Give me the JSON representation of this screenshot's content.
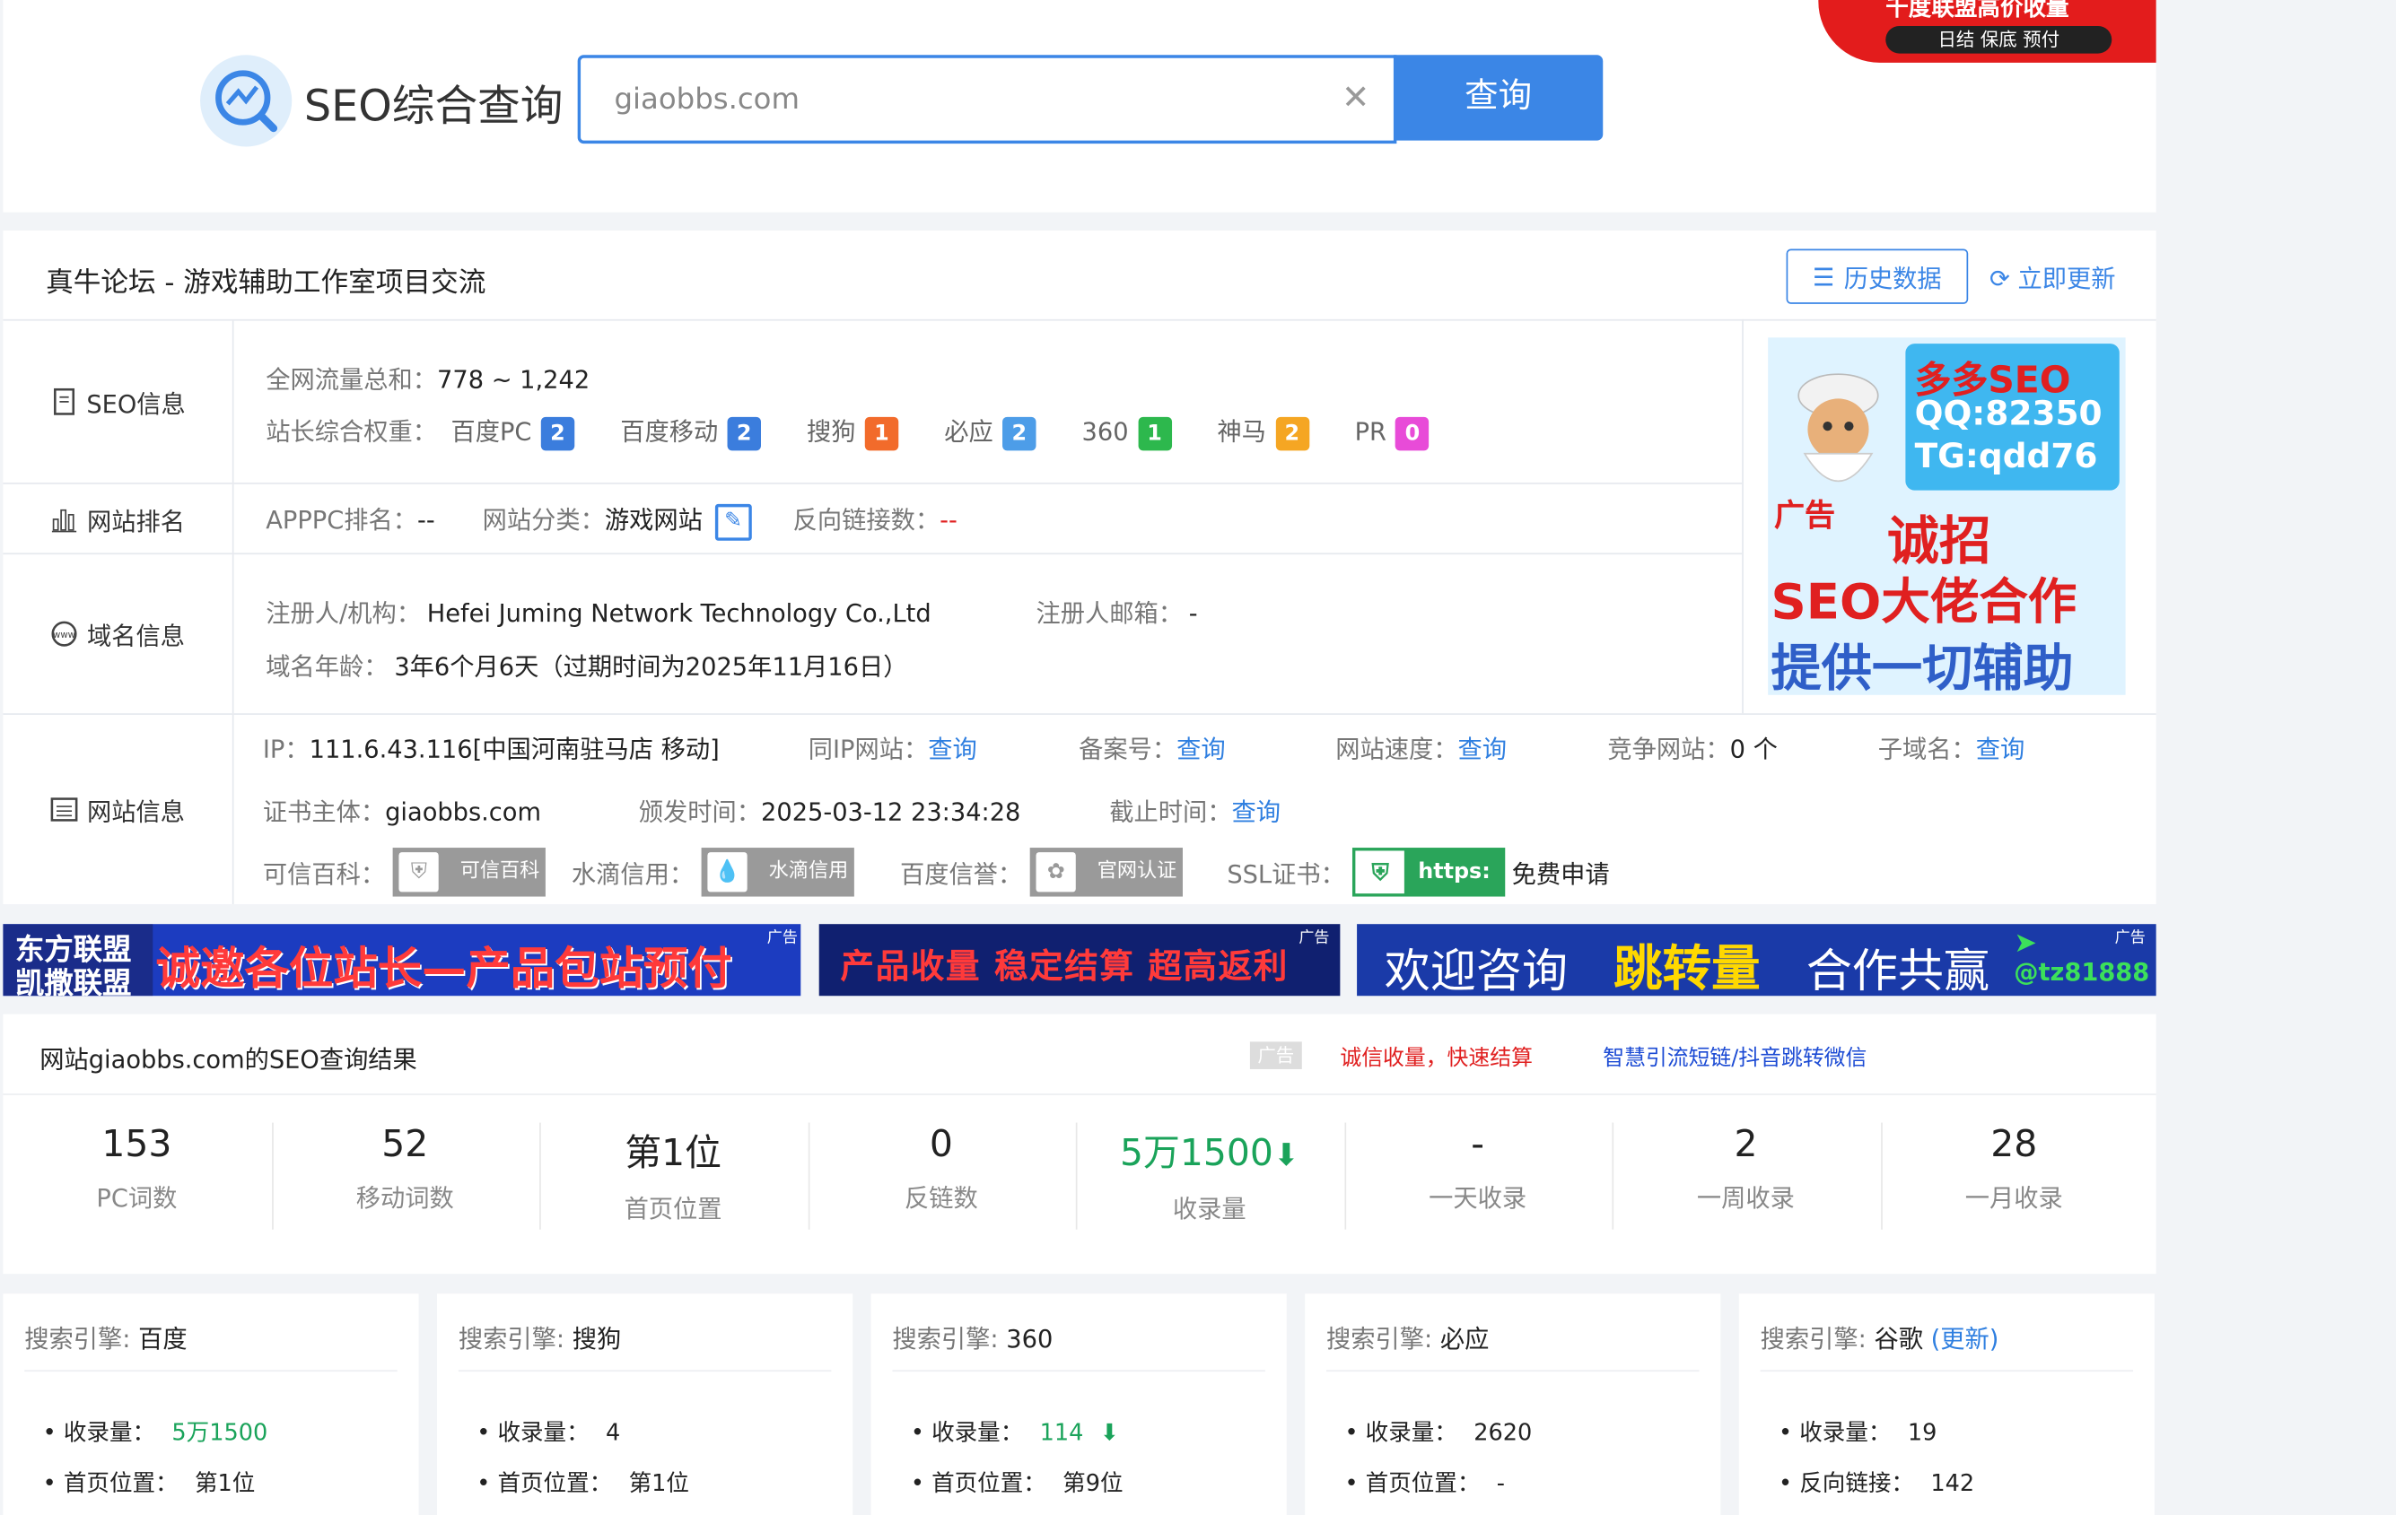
{
  "logo": {
    "title": "SEO综合查询"
  },
  "search": {
    "value": "giaobbs.com",
    "button": "查询"
  },
  "top_ad": {
    "line1": "千度联盟高价收量",
    "line2": "日结 保底 预付"
  },
  "site": {
    "title": "真牛论坛 - 游戏辅助工作室项目交流",
    "history_btn": "历史数据",
    "update_btn": "立即更新"
  },
  "seo_info": {
    "label": "SEO信息",
    "traffic_label": "全网流量总和：",
    "traffic_value": "778 ~ 1,242",
    "weight_label": "站长综合权重：",
    "weights": [
      {
        "name": "百度PC",
        "value": "2",
        "color": "#3b7ddd"
      },
      {
        "name": "百度移动",
        "value": "2",
        "color": "#3b7ddd"
      },
      {
        "name": "搜狗",
        "value": "1",
        "color": "#f26b2b"
      },
      {
        "name": "必应",
        "value": "2",
        "color": "#4d9de8"
      },
      {
        "name": "360",
        "value": "1",
        "color": "#2db84d"
      },
      {
        "name": "神马",
        "value": "2",
        "color": "#f5a623"
      },
      {
        "name": "PR",
        "value": "0",
        "color": "#e84bd8"
      }
    ]
  },
  "rank_info": {
    "label": "网站排名",
    "apppc_label": "APPPC排名：",
    "apppc_value": "--",
    "category_label": "网站分类：",
    "category_value": "游戏网站",
    "backlink_label": "反向链接数：",
    "backlink_value": "--"
  },
  "domain_info": {
    "label": "域名信息",
    "registrant_label": "注册人/机构：",
    "registrant_value": "Hefei Juming Network Technology Co.,Ltd",
    "email_label": "注册人邮箱：",
    "email_value": "-",
    "age_label": "域名年龄：",
    "age_value": "3年6个月6天（过期时间为2025年11月16日）"
  },
  "web_info": {
    "label": "网站信息",
    "ip_label": "IP：",
    "ip_value": "111.6.43.116[中国河南驻马店 移动]",
    "sameip_label": "同IP网站：",
    "icp_label": "备案号：",
    "speed_label": "网站速度：",
    "compete_label": "竞争网站：",
    "compete_value": "0 个",
    "subdomain_label": "子域名：",
    "query": "查询",
    "cert_label": "证书主体：",
    "cert_value": "giaobbs.com",
    "issued_label": "颁发时间：",
    "issued_value": "2025-03-12 23:34:28",
    "expire_label": "截止时间：",
    "kexin_label": "可信百科：",
    "kexin_badge": "可信百科",
    "shuidi_label": "水滴信用：",
    "shuidi_badge": "水滴信用",
    "baidu_label": "百度信誉：",
    "baidu_badge": "官网认证",
    "ssl_label": "SSL证书：",
    "ssl_badge": "https:",
    "ssl_apply": "免费申请"
  },
  "side_ad": {
    "line1": "多多SEO",
    "line2": "QQ:82350",
    "line3": "TG:qdd76",
    "tag": "广告",
    "line4": "诚招",
    "line5": "SEO大佬合作",
    "line6": "提供一切辅助"
  },
  "banners": [
    {
      "left_top": "东方联盟",
      "left_bottom": "凯撒联盟",
      "text": "诚邀各位站长—产品包站预付",
      "tag": "广告"
    },
    {
      "text": "产品收量 稳定结算 超高返利",
      "tag": "广告"
    },
    {
      "text1": "欢迎咨询",
      "text2": "跳转量",
      "text3": "合作共赢",
      "contact": "@tz81888",
      "tag": "广告"
    }
  ],
  "results": {
    "title": "网站giaobbs.com的SEO查询结果",
    "ad_tag": "广告",
    "ad_link1": "诚信收量，快速结算",
    "ad_link2": "智慧引流短链/抖音跳转微信"
  },
  "stats": [
    {
      "num": "153",
      "cap": "PC词数"
    },
    {
      "num": "52",
      "cap": "移动词数"
    },
    {
      "num": "第1位",
      "cap": "首页位置"
    },
    {
      "num": "0",
      "cap": "反链数"
    },
    {
      "num": "5万1500",
      "cap": "收录量",
      "arrow": "⬇"
    },
    {
      "num": "-",
      "cap": "一天收录"
    },
    {
      "num": "2",
      "cap": "一周收录"
    },
    {
      "num": "28",
      "cap": "一月收录"
    }
  ],
  "engines": [
    {
      "label": "搜索引擎:",
      "name": "百度",
      "r1k": "收录量：",
      "r1v": "5万1500",
      "r2k": "首页位置：",
      "r2v": "第1位"
    },
    {
      "label": "搜索引擎:",
      "name": "搜狗",
      "r1k": "收录量：",
      "r1v": "4",
      "r2k": "首页位置：",
      "r2v": "第1位"
    },
    {
      "label": "搜索引擎:",
      "name": "360",
      "r1k": "收录量：",
      "r1v": "114",
      "r2k": "首页位置：",
      "r2v": "第9位"
    },
    {
      "label": "搜索引擎:",
      "name": "必应",
      "r1k": "收录量：",
      "r1v": "2620",
      "r2k": "首页位置：",
      "r2v": "-"
    },
    {
      "label": "搜索引擎:",
      "name": "谷歌",
      "extra": "(更新)",
      "r1k": "收录量：",
      "r1v": "19",
      "r2k": "反向链接：",
      "r2v": "142"
    }
  ],
  "colors": {
    "accent": "#3b86e6",
    "green": "#1aa35a",
    "red": "#e02020"
  }
}
